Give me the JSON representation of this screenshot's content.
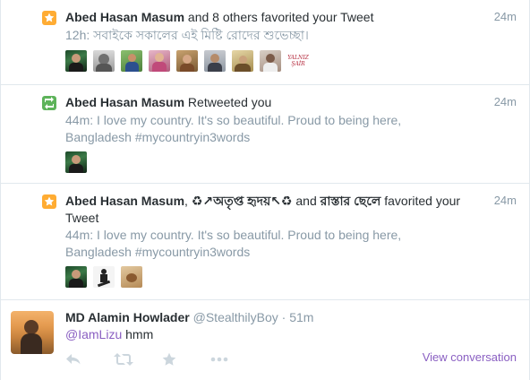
{
  "items": [
    {
      "icon": "star-icon",
      "actor": "Abed Hasan Masum",
      "action_text": " and 8 others favorited your Tweet",
      "time": "24m",
      "subtext": "12h: সবাইকে সকালের এই মিষ্টি রোদের শুভেচ্ছা।",
      "avatar_badge_text": "YALNIZ ŞAİR"
    },
    {
      "icon": "retweet-icon",
      "actor": "Abed Hasan Masum",
      "action_text": " Retweeted you",
      "time": "24m",
      "subtext_line1": "44m: I love my country. It's so beautiful. Proud to being here,",
      "subtext_line2_prefix": "Bangladesh ",
      "subtext_hashtag": "#mycountryin3words"
    },
    {
      "icon": "star-icon",
      "actor": "Abed Hasan Masum",
      "actor2": "♻↗অতৃপ্ত হৃদয়↖♻",
      "and_text": " and ",
      "actor3": "রাস্তার ছেলে",
      "action_text": " favorited your",
      "action_text_line2": "Tweet",
      "time": "24m",
      "subtext_line1": "44m: I love my country. It's so beautiful. Proud to being here,",
      "subtext_line2_prefix": "Bangladesh ",
      "subtext_hashtag": "#mycountryin3words"
    }
  ],
  "tweet": {
    "name": "MD Alamin Howlader",
    "handle": "@StealthilyBoy",
    "separator": " · ",
    "time": "51m",
    "mention": "@IamLizu",
    "text": " hmm",
    "view_conversation": "View conversation",
    "actions": [
      "reply-icon",
      "retweet-icon",
      "favorite-icon",
      "more-icon"
    ]
  },
  "colors": {
    "star": "#ffac33",
    "retweet": "#5db35a",
    "link": "#8a5fc2",
    "muted": "#8899a6",
    "text": "#292f33"
  }
}
